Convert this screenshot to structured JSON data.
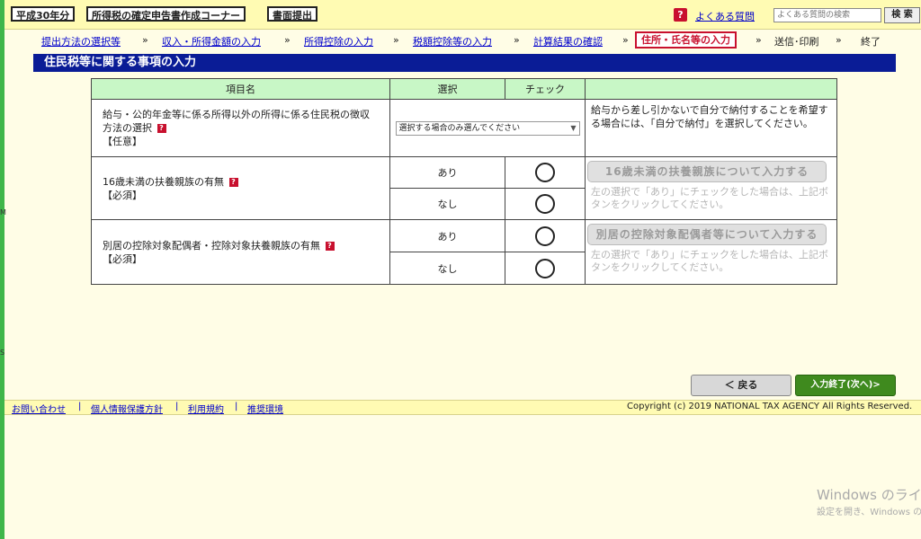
{
  "header": {
    "year_label": "平成30年分",
    "corner_title": "所得税の確定申告書作成コーナー",
    "paper_submit": "書面提出",
    "faq_icon": "?",
    "faq_label": "よくある質問",
    "search_placeholder": "よくある質問の検索",
    "search_button": "検 索"
  },
  "steps": [
    {
      "label": "提出方法の選択等",
      "state": "link"
    },
    {
      "label": "収入・所得金額の入力",
      "state": "link"
    },
    {
      "label": "所得控除の入力",
      "state": "link"
    },
    {
      "label": "税額控除等の入力",
      "state": "link"
    },
    {
      "label": "計算結果の確認",
      "state": "link"
    },
    {
      "label": "住所・氏名等の入力",
      "state": "current"
    },
    {
      "label": "送信･印刷",
      "state": "plain"
    },
    {
      "label": "終了",
      "state": "plain"
    }
  ],
  "step_separator": "»",
  "section_title": "住民税等に関する事項の入力",
  "table": {
    "headers": [
      "項目名",
      "選択",
      "チェック",
      ""
    ],
    "row1": {
      "item": "給与・公的年金等に係る所得以外の所得に係る住民税の徴収方法の選択",
      "tag": "【任意】",
      "select_value": "選択する場合のみ選んでください",
      "note": "給与から差し引かないで自分で納付することを希望する場合には、「自分で納付」を選択してください。"
    },
    "row2": {
      "item": "16歳未満の扶養親族の有無",
      "tag": "【必須】",
      "options": [
        "あり",
        "なし"
      ],
      "button": "16歳未満の扶養親族について入力する",
      "note": "左の選択で「あり」にチェックをした場合は、上記ボタンをクリックしてください。"
    },
    "row3": {
      "item": "別居の控除対象配偶者・控除対象扶養親族の有無",
      "tag": "【必須】",
      "options": [
        "あり",
        "なし"
      ],
      "button": "別居の控除対象配偶者等について入力する",
      "note": "左の選択で「あり」にチェックをした場合は、上記ボタンをクリックしてください。"
    }
  },
  "nav": {
    "back": "＜ 戻る",
    "next": "入力終了(次へ)>"
  },
  "footer": {
    "links": [
      "お問い合わせ",
      "個人情報保護方針",
      "利用規約",
      "推奨環境"
    ],
    "copyright": "Copyright (c) 2019 NATIONAL TAX AGENCY All Rights Reserved."
  },
  "watermark": {
    "line1": "Windows のライセ",
    "line2": "設定を開き、Windows の"
  },
  "colors": {
    "title_bar": "#0a1c96",
    "header_bg": "#fffbb3",
    "table_header": "#c8f7c6",
    "next_button": "#3f8a1e",
    "current_step": "#c8102e"
  }
}
